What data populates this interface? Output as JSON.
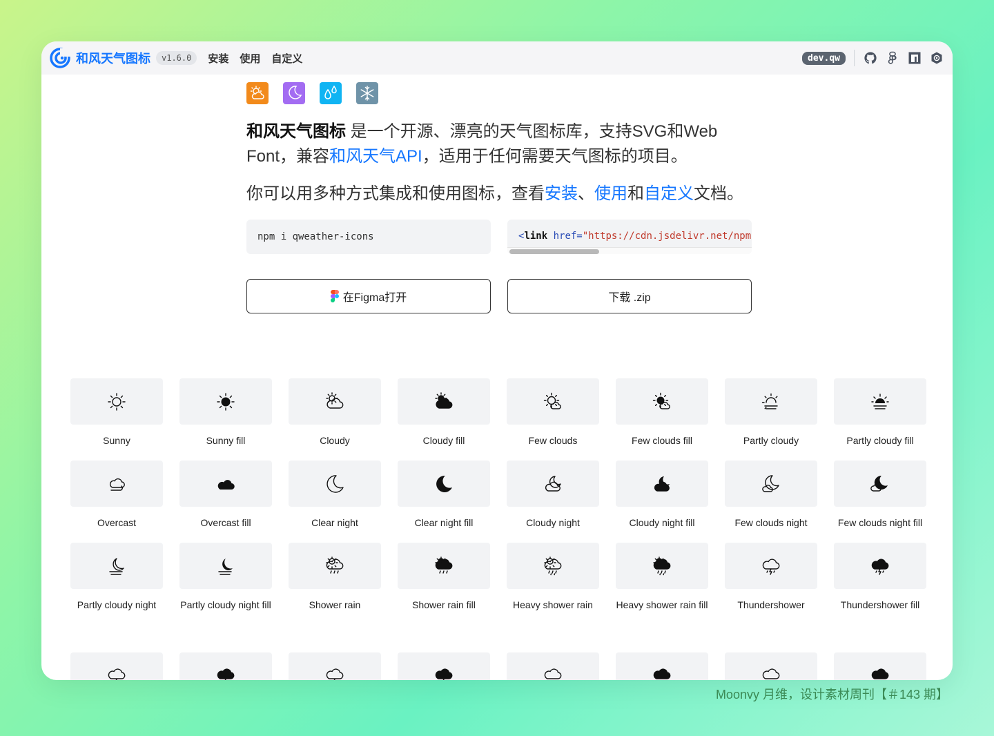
{
  "nav": {
    "brand": "和风天气图标",
    "version": "v1.6.0",
    "links": [
      "安装",
      "使用",
      "自定义"
    ],
    "dev_badge": "dev.qw",
    "icons": [
      "github-icon",
      "figma-icon",
      "npm-icon",
      "shield-icon"
    ]
  },
  "hero": {
    "color_icons": [
      {
        "name": "cloudy-sun-icon",
        "bg": "#f28a1b"
      },
      {
        "name": "moon-icon",
        "bg": "#a36cf2"
      },
      {
        "name": "water-drops-icon",
        "bg": "#10b4f3"
      },
      {
        "name": "snowflake-icon",
        "bg": "#6f93a8"
      }
    ],
    "intro_strong": "和风天气图标",
    "intro_p1": " 是一个开源、漂亮的天气图标库，支持SVG和Web Font，兼容",
    "intro_link": "和风天气API",
    "intro_p2": "，适用于任何需要天气图标的项目。",
    "intro2_p1": "你可以用多种方式集成和使用图标，查看",
    "intro2_link1": "安装",
    "intro2_sep": "、",
    "intro2_link2": "使用",
    "intro2_and": "和",
    "intro2_link3": "自定义",
    "intro2_p2": "文档。"
  },
  "code": {
    "npm": "npm i qweather-icons",
    "link_open": "<",
    "link_kw": "link",
    "link_attr": " href=",
    "link_str": "\"https://cdn.jsdelivr.net/npm/qweather-icons\""
  },
  "buttons": {
    "figma": "在Figma打开",
    "download": "下载 .zip"
  },
  "icons": [
    {
      "label": "Sunny",
      "glyph": "sunny"
    },
    {
      "label": "Sunny fill",
      "glyph": "sunny-fill"
    },
    {
      "label": "Cloudy",
      "glyph": "cloudy"
    },
    {
      "label": "Cloudy fill",
      "glyph": "cloudy-fill"
    },
    {
      "label": "Few clouds",
      "glyph": "few-clouds"
    },
    {
      "label": "Few clouds fill",
      "glyph": "few-clouds-fill"
    },
    {
      "label": "Partly cloudy",
      "glyph": "partly-cloudy"
    },
    {
      "label": "Partly cloudy fill",
      "glyph": "partly-cloudy-fill"
    },
    {
      "label": "Overcast",
      "glyph": "overcast"
    },
    {
      "label": "Overcast fill",
      "glyph": "overcast-fill"
    },
    {
      "label": "Clear night",
      "glyph": "clear-night"
    },
    {
      "label": "Clear night fill",
      "glyph": "clear-night-fill"
    },
    {
      "label": "Cloudy night",
      "glyph": "cloudy-night"
    },
    {
      "label": "Cloudy night fill",
      "glyph": "cloudy-night-fill"
    },
    {
      "label": "Few clouds night",
      "glyph": "few-clouds-night"
    },
    {
      "label": "Few clouds night fill",
      "glyph": "few-clouds-night-fill"
    },
    {
      "label": "Partly cloudy night",
      "glyph": "partly-cloudy-night"
    },
    {
      "label": "Partly cloudy night fill",
      "glyph": "partly-cloudy-night-fill"
    },
    {
      "label": "Shower rain",
      "glyph": "shower-rain"
    },
    {
      "label": "Shower rain fill",
      "glyph": "shower-rain-fill"
    },
    {
      "label": "Heavy shower rain",
      "glyph": "heavy-shower-rain"
    },
    {
      "label": "Heavy shower rain fill",
      "glyph": "heavy-shower-rain-fill"
    },
    {
      "label": "Thundershower",
      "glyph": "thundershower"
    },
    {
      "label": "Thundershower fill",
      "glyph": "thundershower-fill"
    },
    {
      "label": "",
      "glyph": "thunder-hail"
    },
    {
      "label": "",
      "glyph": "thunder-hail-fill"
    },
    {
      "label": "",
      "glyph": "thunder-rain"
    },
    {
      "label": "",
      "glyph": "thunder-rain-fill"
    },
    {
      "label": "",
      "glyph": "light-rain"
    },
    {
      "label": "",
      "glyph": "light-rain-fill"
    },
    {
      "label": "",
      "glyph": "moderate-rain"
    },
    {
      "label": "",
      "glyph": "moderate-rain-fill"
    }
  ],
  "credit": "Moonvy 月维，设计素材周刊【＃143 期】"
}
